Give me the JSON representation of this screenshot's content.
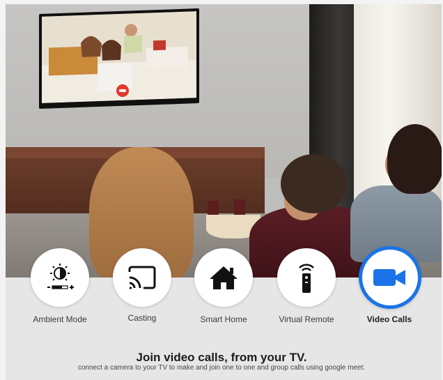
{
  "features": [
    {
      "label": "Ambient Mode",
      "icon": "ambient-mode-icon",
      "active": false
    },
    {
      "label": "Casting",
      "icon": "cast-icon",
      "active": false
    },
    {
      "label": "Smart Home",
      "icon": "home-icon",
      "active": false
    },
    {
      "label": "Virtual Remote",
      "icon": "remote-icon",
      "active": false
    },
    {
      "label": "Video Calls",
      "icon": "video-camera-icon",
      "active": true
    }
  ],
  "headline": "Join video calls, from your TV.",
  "subheadline": "connect a camera to your TV to make and join one to one and group calls using google meet.",
  "colors": {
    "accent": "#1a73e8",
    "call_end": "#e23a2e"
  }
}
